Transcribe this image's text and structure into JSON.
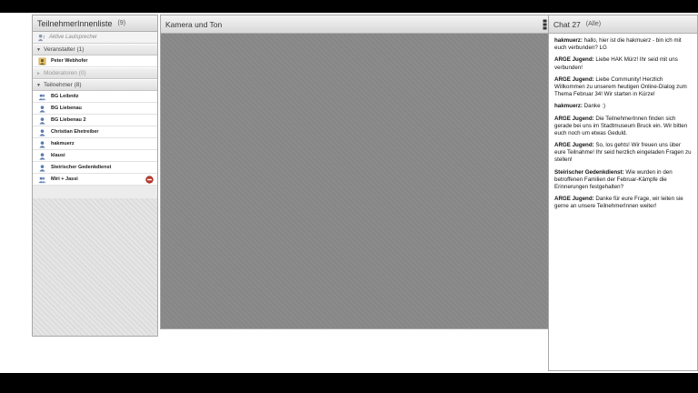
{
  "participants": {
    "title": "TeilnehmerInnenliste",
    "count": "(9)",
    "active_speaker": "Aktive Lautsprecher",
    "groups": [
      {
        "label": "Veranstalter (1)",
        "members": [
          "Peter Webhofer"
        ]
      },
      {
        "label": "Moderatoren (0)",
        "members": []
      },
      {
        "label": "Teilnehmer (8)",
        "members": [
          "BG Leibnitz",
          "BG Liebenau",
          "BG Liebenau 2",
          "Christian Ehetreiber",
          "hakmuerz",
          "klausi",
          "Steirischer Gedenkdienst",
          "Miri + Jassi"
        ]
      }
    ]
  },
  "camera": {
    "title": "Kamera und Ton"
  },
  "chat": {
    "title": "Chat 27",
    "scope": "(Alle)",
    "messages": [
      {
        "sender": "hakmuerz:",
        "text": " hallo, hier ist die hakmuerz - bin ich mit euch verbunden? LG"
      },
      {
        "sender": "ARGE Jugend:",
        "text": " Liebe HAK Mürz! Ihr seid mit uns verbunden!"
      },
      {
        "sender": "ARGE Jugend:",
        "text": " Liebe Community! Herzlich Willkommen zu unserem heutigen Online-Dialog zum Thema Februar 34! Wir starten in Kürze!"
      },
      {
        "sender": "hakmuerz:",
        "text": " Danke :)"
      },
      {
        "sender": "ARGE Jugend:",
        "text": " Die TeilnehmerInnen finden sich gerade bei uns im Stadtmuseum Bruck ein. Wir bitten euch noch um etwas Geduld."
      },
      {
        "sender": "ARGE Jugend:",
        "text": " So, los gehts! Wir freuen uns über eure Teilnahme! Ihr seid herzlich eingeladen Fragen zu stellen!"
      },
      {
        "sender": "Steirischer Gedenkdienst:",
        "text": " Wie wurden in den betroffenen Familien der Februar-Kämpfe die Erinnerungen festgehalten?"
      },
      {
        "sender": "ARGE Jugend:",
        "text": " Danke für eure Frage, wir leiten sie gerne an unsere TeilnehmerInnen weiter!"
      }
    ]
  }
}
